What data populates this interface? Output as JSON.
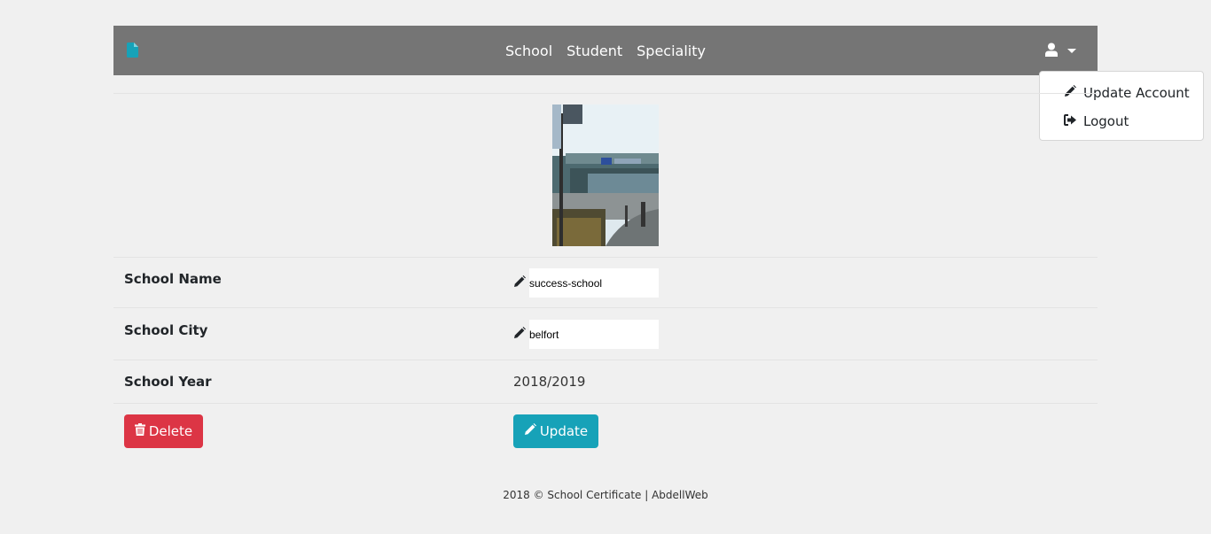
{
  "navbar": {
    "brand_icon": "file-icon",
    "brand_color": "#17a2b8",
    "links": [
      {
        "label": "School"
      },
      {
        "label": "Student"
      },
      {
        "label": "Speciality"
      }
    ],
    "user_icon": "user-icon"
  },
  "dropdown": {
    "items": [
      {
        "label": "Update Account",
        "icon": "pencil-icon"
      },
      {
        "label": "Logout",
        "icon": "sign-out-icon"
      }
    ]
  },
  "school": {
    "photo_icon": "school-building-photo",
    "name_label": "School Name",
    "name_value": "success-school",
    "city_label": "School City",
    "city_value": "belfort",
    "year_label": "School Year",
    "year_value": "2018/2019"
  },
  "actions": {
    "delete_label": "Delete",
    "delete_color": "#dc3545",
    "update_label": "Update",
    "update_color": "#17a2b8"
  },
  "footer": {
    "text": "2018 © School Certificate | AbdellWeb"
  }
}
